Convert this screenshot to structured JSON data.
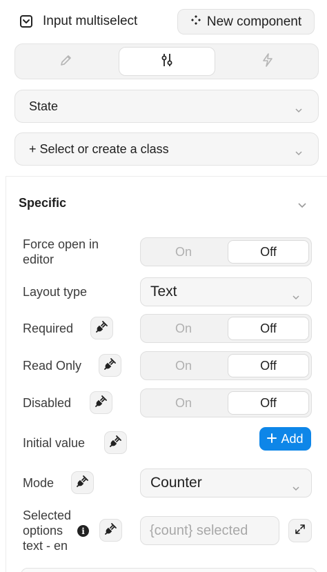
{
  "header": {
    "title": "Input multiselect",
    "new_component_label": "New component"
  },
  "tabs": [
    {
      "icon": "pencil-icon",
      "active": false
    },
    {
      "icon": "sliders-icon",
      "active": true
    },
    {
      "icon": "lightning-icon",
      "active": false
    }
  ],
  "state_select": {
    "label": "State"
  },
  "class_select": {
    "label": "+ Select or create a class"
  },
  "specific": {
    "title": "Specific",
    "force_open": {
      "label": "Force open in editor",
      "on": "On",
      "off": "Off",
      "value": "Off"
    },
    "layout_type": {
      "label": "Layout type",
      "value": "Text"
    },
    "required": {
      "label": "Required",
      "on": "On",
      "off": "Off",
      "value": "Off"
    },
    "read_only": {
      "label": "Read Only",
      "on": "On",
      "off": "Off",
      "value": "Off"
    },
    "disabled": {
      "label": "Disabled",
      "on": "On",
      "off": "Off",
      "value": "Off"
    },
    "initial_value": {
      "label": "Initial value",
      "add_label": "Add"
    },
    "mode": {
      "label": "Mode",
      "value": "Counter"
    },
    "selected_text": {
      "label_lines": [
        "Selected",
        "options",
        "text - en"
      ],
      "placeholder": "{count} selected"
    }
  },
  "colors": {
    "accent": "#0e86e8"
  }
}
